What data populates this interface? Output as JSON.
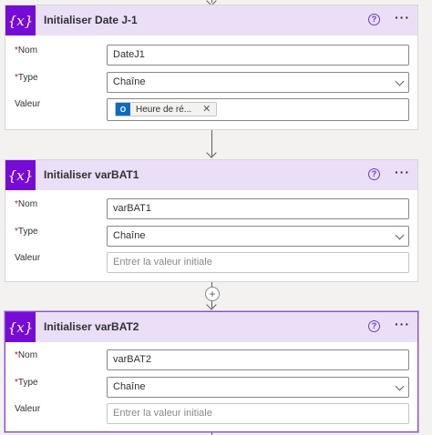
{
  "cards": [
    {
      "title": "Initialiser Date J-1",
      "nom_label": "Nom",
      "nom_value": "DateJ1",
      "type_label": "Type",
      "type_value": "Chaîne",
      "valeur_label": "Valeur",
      "valeur_token": "Heure de ré...",
      "token_close": "✕"
    },
    {
      "title": "Initialiser varBAT1",
      "nom_label": "Nom",
      "nom_value": "varBAT1",
      "type_label": "Type",
      "type_value": "Chaîne",
      "valeur_label": "Valeur",
      "valeur_placeholder": "Entrer la valeur initiale"
    },
    {
      "title": "Initialiser varBAT2",
      "nom_label": "Nom",
      "nom_value": "varBAT2",
      "type_label": "Type",
      "type_value": "Chaîne",
      "valeur_label": "Valeur",
      "valeur_placeholder": "Entrer la valeur initiale"
    }
  ],
  "common": {
    "required_marker": "*",
    "card_icon_text": "{x}",
    "help_icon_text": "?",
    "more_icon_text": "···",
    "token_icon_text": "O",
    "add_step_text": "+"
  },
  "colors": {
    "accent": "#770bd6",
    "header_bg": "#eadff7",
    "token_icon_bg": "#0f6cbd",
    "selected_border": "#8a4fc7"
  },
  "icons": [
    "variable-icon",
    "help-icon",
    "more-options-icon",
    "chevron-down-icon",
    "outlook-icon",
    "close-icon",
    "add-step-icon",
    "arrow-down-icon"
  ]
}
